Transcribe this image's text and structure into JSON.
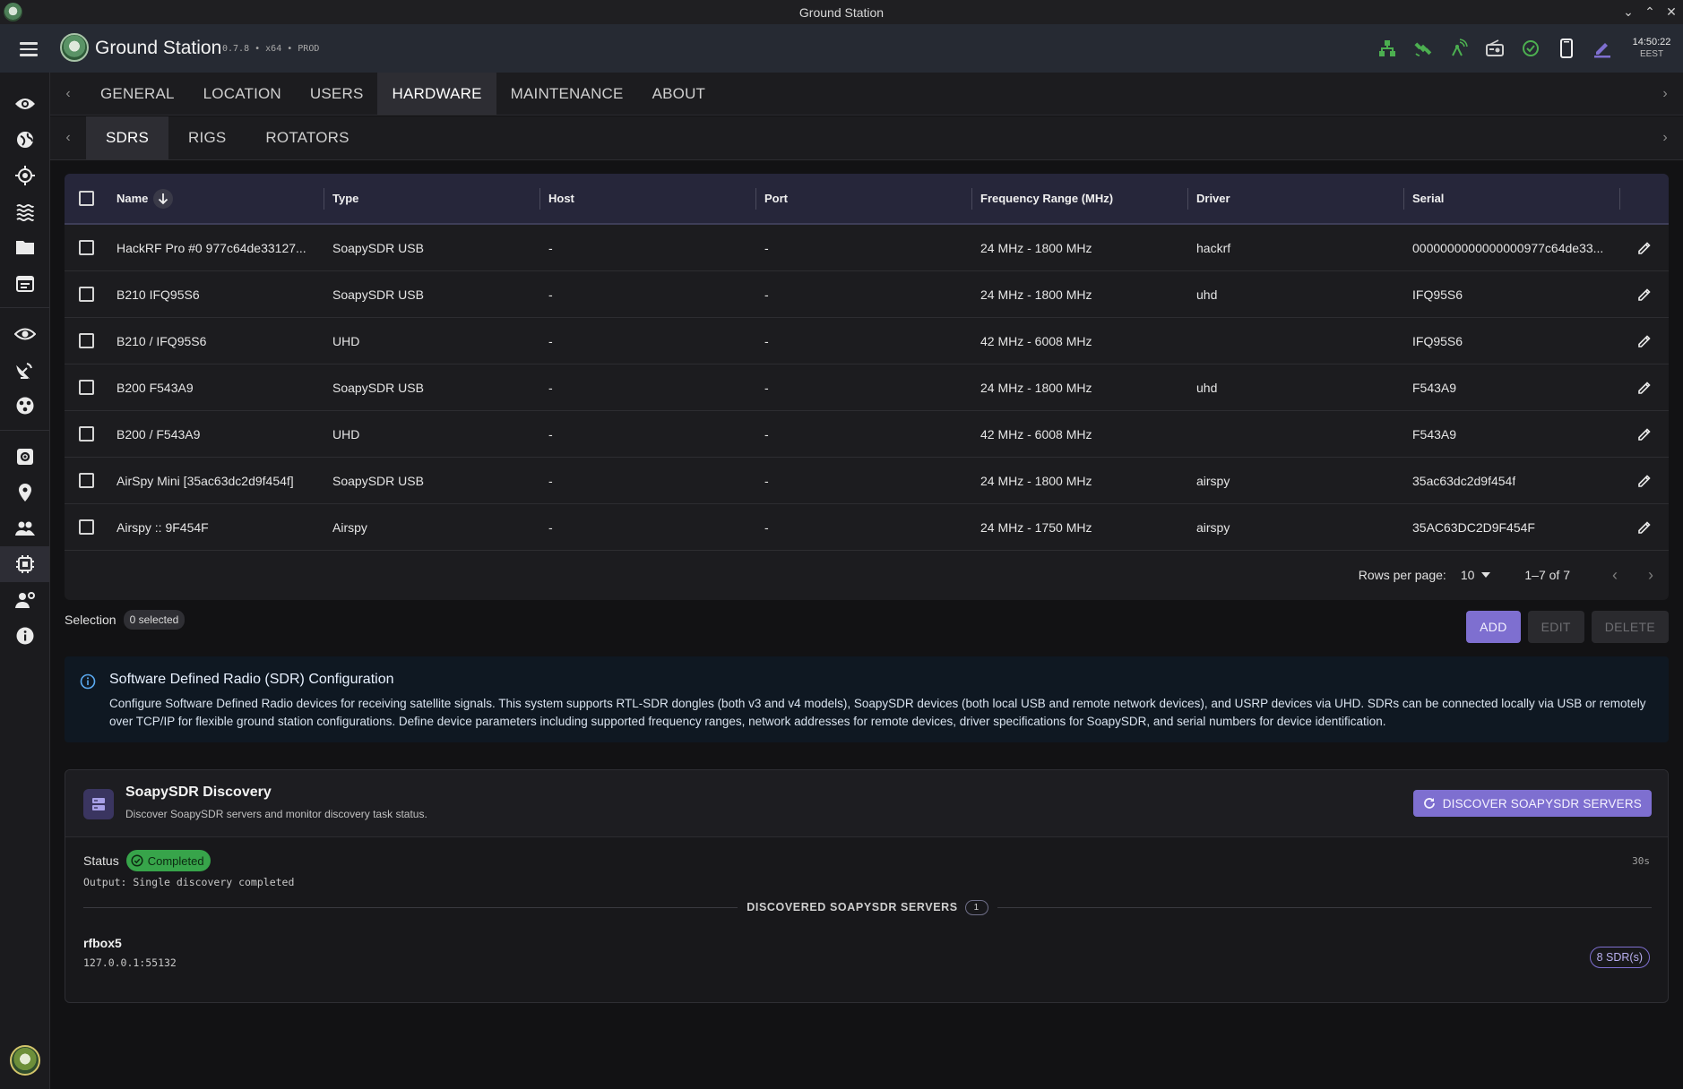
{
  "window": {
    "title": "Ground Station"
  },
  "appbar": {
    "title": "Ground Station",
    "version": "0.7.8 • x64 • PROD",
    "clock_time": "14:50:22",
    "clock_tz": "EEST",
    "status_icons": [
      "network-icon",
      "satellite-icon",
      "antenna-icon",
      "radio-icon",
      "check-circle-icon",
      "phone-icon",
      "edit-icon"
    ],
    "colors": {
      "status_green": "#4caf50",
      "accent": "#7e6fd0"
    }
  },
  "tabs": {
    "top": [
      "GENERAL",
      "LOCATION",
      "USERS",
      "HARDWARE",
      "MAINTENANCE",
      "ABOUT"
    ],
    "top_active": "HARDWARE",
    "sub": [
      "SDRS",
      "RIGS",
      "ROTATORS"
    ],
    "sub_active": "SDRS"
  },
  "table": {
    "columns": [
      "Name",
      "Type",
      "Host",
      "Port",
      "Frequency Range (MHz)",
      "Driver",
      "Serial"
    ],
    "rows": [
      {
        "name": "HackRF Pro #0 977c64de33127...",
        "type": "SoapySDR USB",
        "host": "-",
        "port": "-",
        "freq": "24 MHz - 1800 MHz",
        "driver": "hackrf",
        "serial": "0000000000000000977c64de33..."
      },
      {
        "name": "B210 IFQ95S6",
        "type": "SoapySDR USB",
        "host": "-",
        "port": "-",
        "freq": "24 MHz - 1800 MHz",
        "driver": "uhd",
        "serial": "IFQ95S6"
      },
      {
        "name": "B210 / IFQ95S6",
        "type": "UHD",
        "host": "-",
        "port": "-",
        "freq": "42 MHz - 6008 MHz",
        "driver": "",
        "serial": "IFQ95S6"
      },
      {
        "name": "B200 F543A9",
        "type": "SoapySDR USB",
        "host": "-",
        "port": "-",
        "freq": "24 MHz - 1800 MHz",
        "driver": "uhd",
        "serial": "F543A9"
      },
      {
        "name": "B200 / F543A9",
        "type": "UHD",
        "host": "-",
        "port": "-",
        "freq": "42 MHz - 6008 MHz",
        "driver": "",
        "serial": "F543A9"
      },
      {
        "name": "AirSpy Mini [35ac63dc2d9f454f]",
        "type": "SoapySDR USB",
        "host": "-",
        "port": "-",
        "freq": "24 MHz - 1800 MHz",
        "driver": "airspy",
        "serial": "35ac63dc2d9f454f"
      },
      {
        "name": "Airspy :: 9F454F",
        "type": "Airspy",
        "host": "-",
        "port": "-",
        "freq": "24 MHz - 1750 MHz",
        "driver": "airspy",
        "serial": "35AC63DC2D9F454F"
      }
    ],
    "footer": {
      "rows_per_page_label": "Rows per page:",
      "rows_per_page": "10",
      "range": "1–7 of 7"
    }
  },
  "selection": {
    "label": "Selection",
    "badge": "0 selected"
  },
  "actions": {
    "add": "ADD",
    "edit": "EDIT",
    "delete": "DELETE"
  },
  "info": {
    "title": "Software Defined Radio (SDR) Configuration",
    "body": "Configure Software Defined Radio devices for receiving satellite signals. This system supports RTL-SDR dongles (both v3 and v4 models), SoapySDR devices (both local USB and remote network devices), and USRP devices via UHD. SDRs can be connected locally via USB or remotely over TCP/IP for flexible ground station configurations. Define device parameters including supported frequency ranges, network addresses for remote devices, driver specifications for SoapySDR, and serial numbers for device identification."
  },
  "discovery": {
    "title": "SoapySDR Discovery",
    "subtitle": "Discover SoapySDR servers and monitor discovery task status.",
    "button": "DISCOVER SOAPYSDR SERVERS",
    "status_label": "Status",
    "status": "Completed",
    "elapsed": "30s",
    "output": "Output: Single discovery completed",
    "servers_label": "DISCOVERED SOAPYSDR SERVERS",
    "servers_count": "1",
    "servers": [
      {
        "name": "rfbox5",
        "address": "127.0.0.1:55132",
        "sdr_count": "8 SDR(s)"
      }
    ]
  }
}
